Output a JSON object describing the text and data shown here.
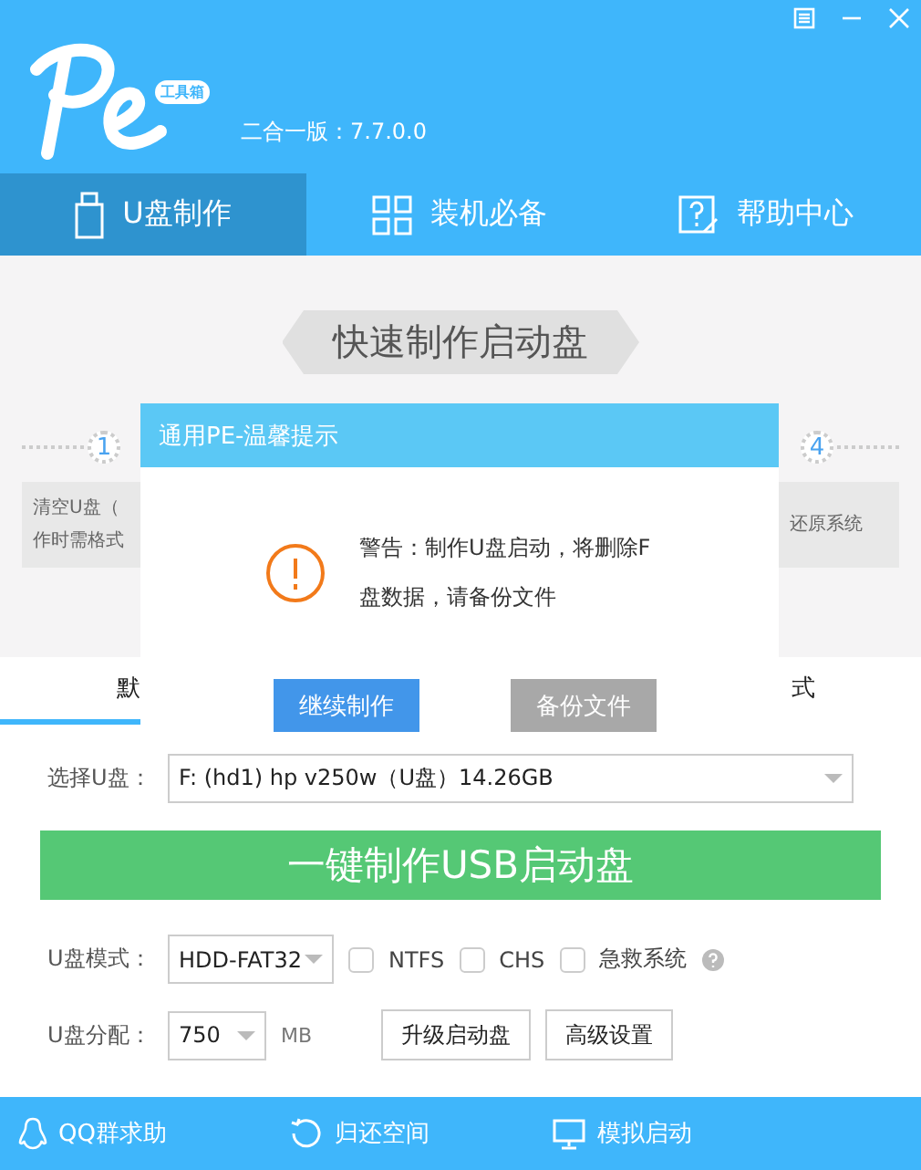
{
  "header": {
    "logo_badge": "工具箱",
    "version": "二合一版：7.7.0.0"
  },
  "tabs": [
    {
      "label": "U盘制作",
      "selected": true
    },
    {
      "label": "装机必备",
      "selected": false
    },
    {
      "label": "帮助中心",
      "selected": false
    }
  ],
  "banner": "快速制作启动盘",
  "steps": [
    {
      "number": "1",
      "lines": [
        "清空U盘（",
        "作时需格式"
      ]
    },
    {
      "number": "4",
      "lines": [
        "还原系统"
      ]
    }
  ],
  "mode_tabs": [
    {
      "label": "默",
      "selected": true
    },
    {
      "label": "式",
      "selected": false
    }
  ],
  "dialog": {
    "title": "通用PE-温馨提示",
    "message": "警告：制作U盘启动，将删除F盘数据，请备份文件",
    "buttons": [
      {
        "label": "继续制作",
        "primary": true
      },
      {
        "label": "备份文件",
        "primary": false
      }
    ]
  },
  "drive": {
    "label": "选择U盘：",
    "value": "F: (hd1) hp v250w（U盘）14.26GB"
  },
  "make_button": "一键制作USB启动盘",
  "mode": {
    "label": "U盘模式：",
    "value": "HDD-FAT32",
    "options": [
      {
        "label": "NTFS",
        "checked": false
      },
      {
        "label": "CHS",
        "checked": false
      },
      {
        "label": "急救系统",
        "checked": false
      }
    ]
  },
  "partition": {
    "label": "U盘分配：",
    "value": "750",
    "unit": "MB",
    "buttons": [
      "升级启动盘",
      "高级设置"
    ]
  },
  "footer": [
    {
      "label": "QQ群求助"
    },
    {
      "label": "归还空间"
    },
    {
      "label": "模拟启动"
    }
  ]
}
